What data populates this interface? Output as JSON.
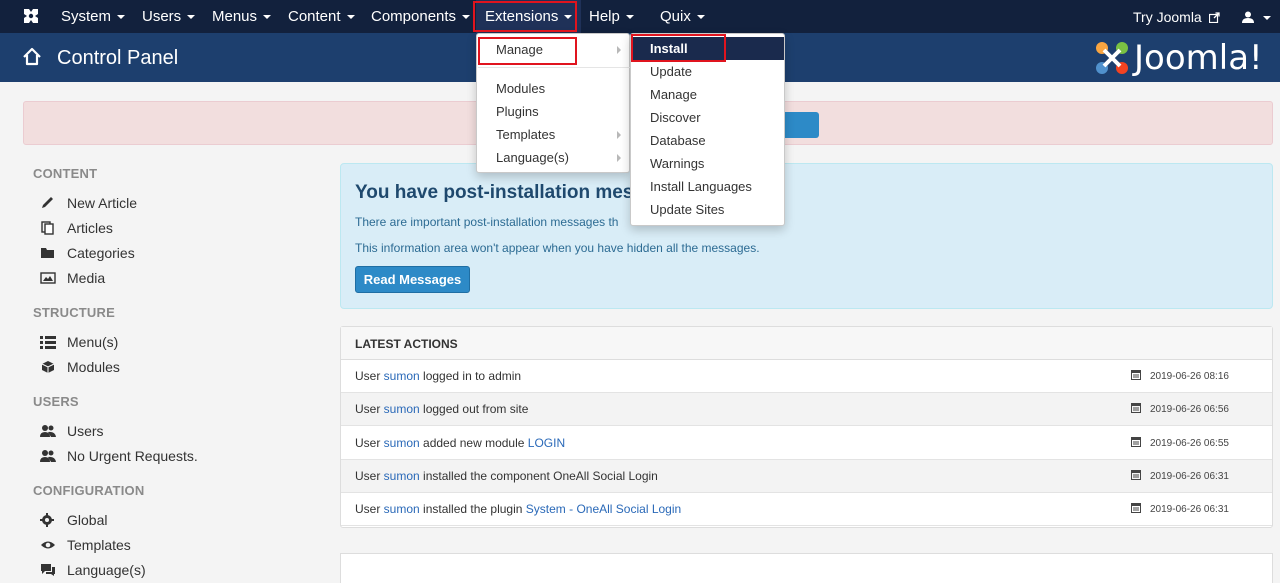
{
  "navbar": {
    "items": [
      {
        "label": "System"
      },
      {
        "label": "Users"
      },
      {
        "label": "Menus"
      },
      {
        "label": "Content"
      },
      {
        "label": "Components"
      },
      {
        "label": "Extensions"
      },
      {
        "label": "Help"
      },
      {
        "label": "Quix"
      }
    ],
    "try_joomla": "Try Joomla"
  },
  "header": {
    "title": "Control Panel",
    "brand": "Joomla!"
  },
  "sidebar": {
    "sections": [
      {
        "heading": "CONTENT",
        "items": [
          {
            "label": "New Article",
            "icon": "pencil-icon"
          },
          {
            "label": "Articles",
            "icon": "stack-icon"
          },
          {
            "label": "Categories",
            "icon": "folder-icon"
          },
          {
            "label": "Media",
            "icon": "image-icon"
          }
        ]
      },
      {
        "heading": "STRUCTURE",
        "items": [
          {
            "label": "Menu(s)",
            "icon": "list-icon"
          },
          {
            "label": "Modules",
            "icon": "cube-icon"
          }
        ]
      },
      {
        "heading": "USERS",
        "items": [
          {
            "label": "Users",
            "icon": "users-icon"
          },
          {
            "label": "No Urgent Requests.",
            "icon": "users-icon"
          }
        ]
      },
      {
        "heading": "CONFIGURATION",
        "items": [
          {
            "label": "Global",
            "icon": "gear-icon"
          },
          {
            "label": "Templates",
            "icon": "eye-icon"
          },
          {
            "label": "Language(s)",
            "icon": "comments-icon"
          }
        ]
      }
    ]
  },
  "postinstall": {
    "title": "You have post-installation messag",
    "line1": "There are important post-installation messages th",
    "line2": "This information area won't appear when you have hidden all the messages.",
    "button": "Read Messages"
  },
  "latest_actions": {
    "title": "LATEST ACTIONS",
    "rows": [
      {
        "prefix": "User ",
        "user": "sumon",
        "action": " logged in to admin",
        "link": "",
        "date": "2019-06-26 08:16"
      },
      {
        "prefix": "User ",
        "user": "sumon",
        "action": " logged out from site",
        "link": "",
        "date": "2019-06-26 06:56"
      },
      {
        "prefix": "User ",
        "user": "sumon",
        "action": " added new module ",
        "link": "LOGIN",
        "date": "2019-06-26 06:55"
      },
      {
        "prefix": "User ",
        "user": "sumon",
        "action": " installed the component OneAll Social Login",
        "link": "",
        "date": "2019-06-26 06:31"
      },
      {
        "prefix": "User ",
        "user": "sumon",
        "action": " installed the plugin ",
        "link": "System - OneAll Social Login",
        "date": "2019-06-26 06:31"
      }
    ]
  },
  "extensions_menu": {
    "items": [
      "Manage",
      "Modules",
      "Plugins",
      "Templates",
      "Language(s)"
    ]
  },
  "manage_submenu": {
    "items": [
      "Install",
      "Update",
      "Manage",
      "Discover",
      "Database",
      "Warnings",
      "Install Languages",
      "Update Sites"
    ]
  },
  "colors": {
    "navbar": "#12213d",
    "header": "#1d3f6e",
    "highlight_box": "#e0141e",
    "link": "#2a69b8"
  }
}
